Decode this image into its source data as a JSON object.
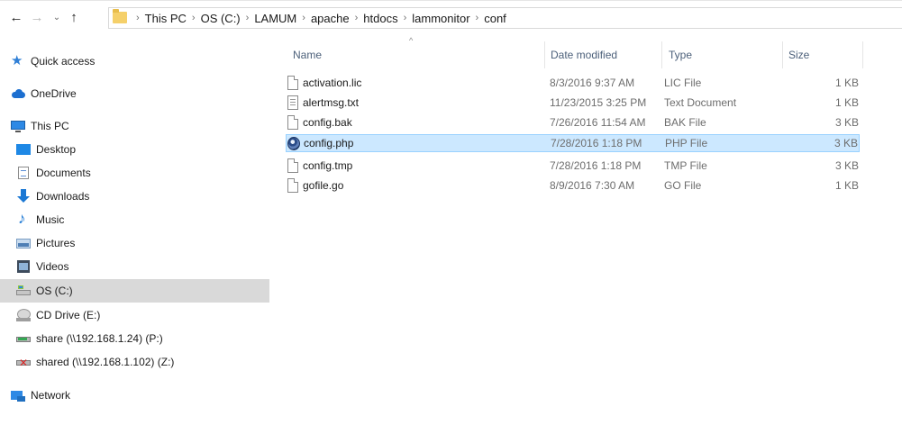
{
  "nav": {
    "back_icon": "arrow-left-icon",
    "forward_icon": "arrow-right-icon",
    "recent_icon": "chevron-down-icon",
    "up_icon": "arrow-up-icon"
  },
  "address": {
    "folder_icon": "folder-icon",
    "breadcrumbs": [
      "This PC",
      "OS (C:)",
      "LAMUM",
      "apache",
      "htdocs",
      "lammonitor",
      "conf"
    ]
  },
  "sidebar": {
    "items": [
      {
        "label": "Quick access",
        "icon": "star-icon"
      },
      {
        "label": "OneDrive",
        "icon": "cloud-icon"
      },
      {
        "label": "This PC",
        "icon": "computer-icon"
      },
      {
        "label": "Desktop",
        "icon": "desktop-icon"
      },
      {
        "label": "Documents",
        "icon": "documents-icon"
      },
      {
        "label": "Downloads",
        "icon": "downloads-icon"
      },
      {
        "label": "Music",
        "icon": "music-icon"
      },
      {
        "label": "Pictures",
        "icon": "pictures-icon"
      },
      {
        "label": "Videos",
        "icon": "videos-icon"
      },
      {
        "label": "OS (C:)",
        "icon": "drive-icon",
        "selected": true
      },
      {
        "label": "CD Drive (E:)",
        "icon": "cd-drive-icon"
      },
      {
        "label": "share (\\\\192.168.1.24) (P:)",
        "icon": "network-drive-icon"
      },
      {
        "label": "shared (\\\\192.168.1.102) (Z:)",
        "icon": "disconnected-drive-icon"
      },
      {
        "label": "Network",
        "icon": "network-icon"
      }
    ]
  },
  "columns": {
    "name": "Name",
    "date": "Date modified",
    "type": "Type",
    "size": "Size"
  },
  "files": [
    {
      "name": "activation.lic",
      "date": "8/3/2016 9:37 AM",
      "type": "LIC File",
      "size": "1 KB",
      "icon": "file-icon"
    },
    {
      "name": "alertmsg.txt",
      "date": "11/23/2015 3:25 PM",
      "type": "Text Document",
      "size": "1 KB",
      "icon": "text-file-icon"
    },
    {
      "name": "config.bak",
      "date": "7/26/2016 11:54 AM",
      "type": "BAK File",
      "size": "3 KB",
      "icon": "file-icon"
    },
    {
      "name": "config.php",
      "date": "7/28/2016 1:18 PM",
      "type": "PHP File",
      "size": "3 KB",
      "icon": "php-file-icon",
      "selected": true
    },
    {
      "name": "config.tmp",
      "date": "7/28/2016 1:18 PM",
      "type": "TMP File",
      "size": "3 KB",
      "icon": "file-icon"
    },
    {
      "name": "gofile.go",
      "date": "8/9/2016 7:30 AM",
      "type": "GO File",
      "size": "1 KB",
      "icon": "file-icon"
    }
  ],
  "colors": {
    "selection_bg": "#cce8ff",
    "selection_border": "#99d1ff",
    "sidebar_selected": "#d9d9d9",
    "header_text": "#4c607a"
  }
}
